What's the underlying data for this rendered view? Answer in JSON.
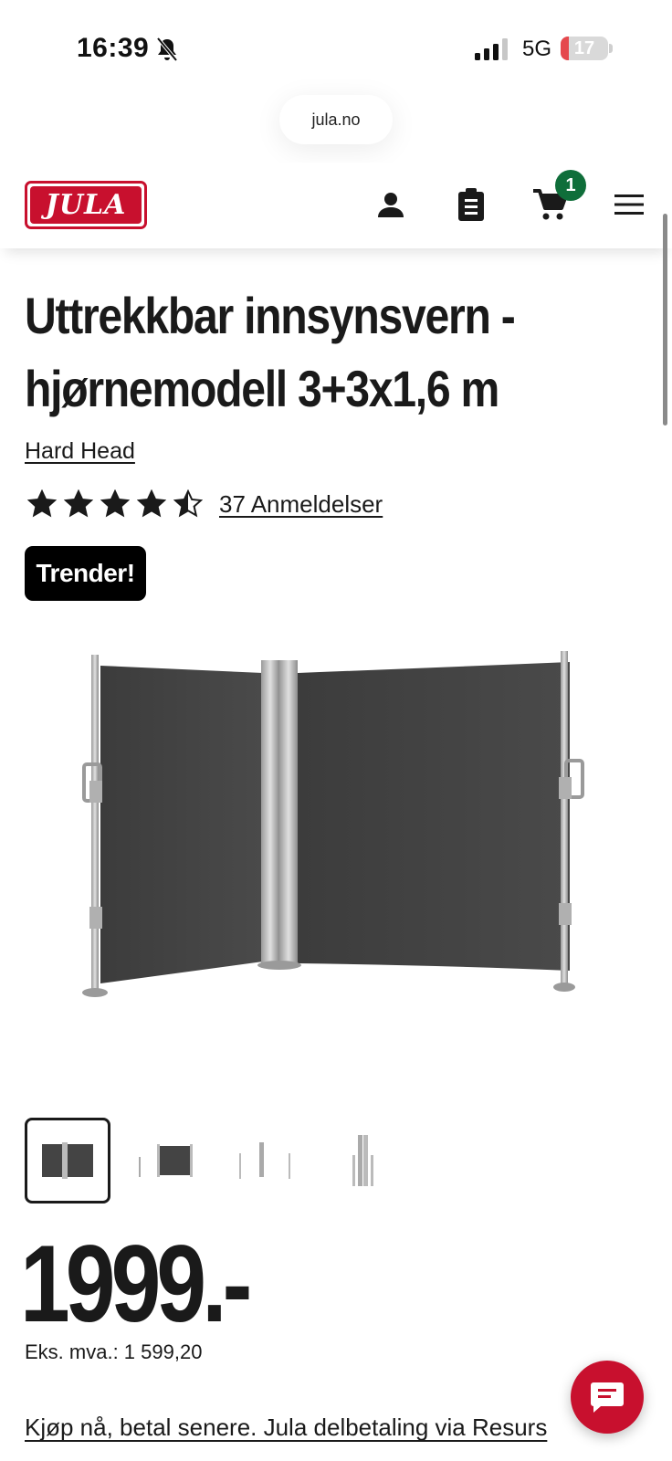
{
  "status_bar": {
    "time": "16:39",
    "network": "5G",
    "battery": "17",
    "battery_level": 0.17
  },
  "browser": {
    "url": "jula.no"
  },
  "header": {
    "logo_text": "JULA",
    "cart_count": "1"
  },
  "product": {
    "title": "Uttrekkbar innsynsvern - hjørnemodell 3+3x1,6 m",
    "brand": "Hard Head",
    "rating": 4.5,
    "reviews_label": "37 Anmeldelser",
    "badge": "Trender!",
    "thumbnail_count": 4,
    "price": "1999.-",
    "price_ex_vat": "Eks. mva.: 1 599,20",
    "pay_later": "Kjøp nå, betal senere. Jula delbetaling via Resurs"
  },
  "colors": {
    "brand_red": "#c8102e",
    "badge_green": "#0f6e3a",
    "text": "#1a1a1a"
  },
  "icons": {
    "account": "user-icon",
    "list": "clipboard-icon",
    "cart": "cart-icon",
    "menu": "hamburger-menu-icon",
    "chat": "chat-icon"
  }
}
